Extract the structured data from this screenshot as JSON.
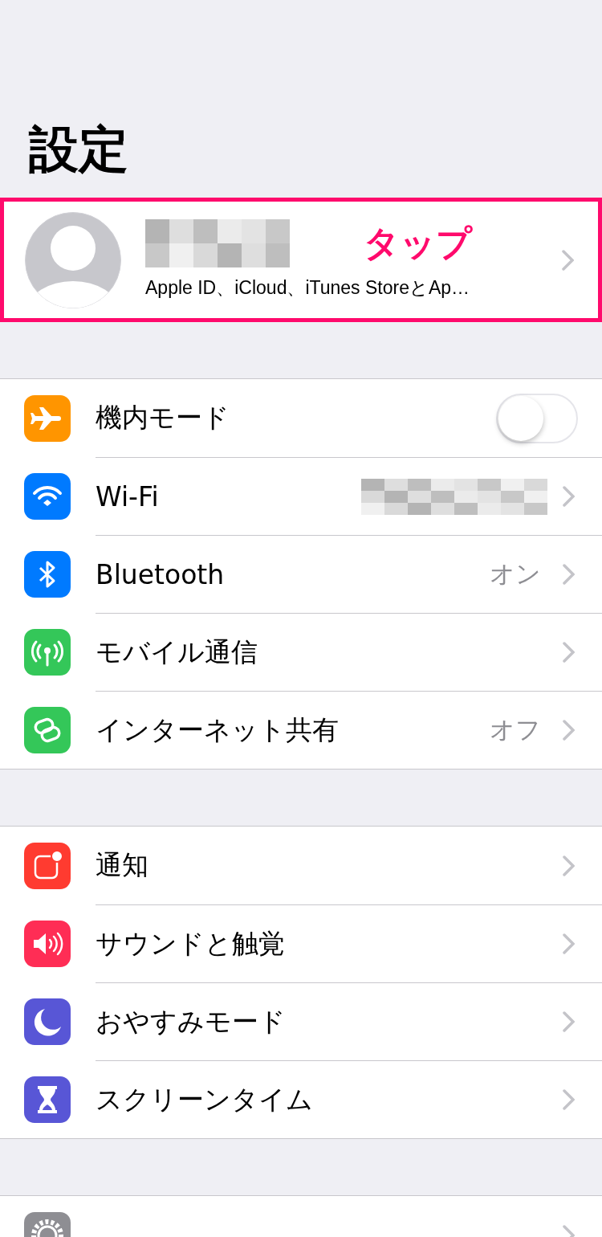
{
  "title": "設定",
  "profile": {
    "name_redacted": true,
    "subtitle": "Apple ID、iCloud、iTunes StoreとAp…",
    "annotation": "タップ",
    "highlighted": true
  },
  "groups": [
    {
      "rows": [
        {
          "kind": "toggle",
          "label": "機内モード",
          "on": false
        },
        {
          "kind": "link",
          "label": "Wi-Fi",
          "value_redacted": true
        },
        {
          "kind": "link",
          "label": "Bluetooth",
          "value": "オン"
        },
        {
          "kind": "link",
          "label": "モバイル通信"
        },
        {
          "kind": "link",
          "label": "インターネット共有",
          "value": "オフ"
        }
      ]
    },
    {
      "rows": [
        {
          "kind": "link",
          "label": "通知"
        },
        {
          "kind": "link",
          "label": "サウンドと触覚"
        },
        {
          "kind": "link",
          "label": "おやすみモード"
        },
        {
          "kind": "link",
          "label": "スクリーンタイム"
        }
      ]
    },
    {
      "rows": [
        {
          "kind": "link"
        }
      ]
    }
  ]
}
